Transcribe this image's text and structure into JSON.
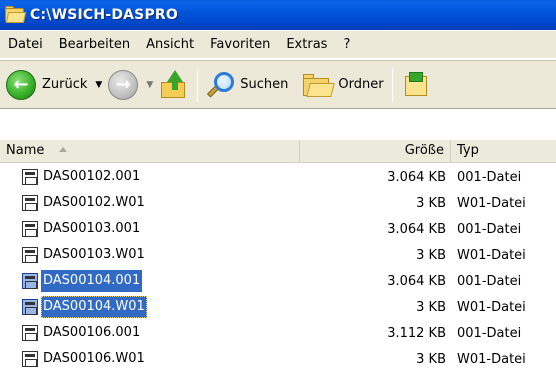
{
  "window": {
    "title": "C:\\WSICH-DASPRO"
  },
  "menu": {
    "items": [
      "Datei",
      "Bearbeiten",
      "Ansicht",
      "Favoriten",
      "Extras",
      "?"
    ]
  },
  "toolbar": {
    "back_label": "Zurück",
    "search_label": "Suchen",
    "folders_label": "Ordner",
    "icons": [
      "back-arrow-icon",
      "forward-arrow-icon",
      "folder-up-icon",
      "search-icon",
      "folders-icon",
      "views-icon"
    ]
  },
  "columns": {
    "name": "Name",
    "size": "Größe",
    "type": "Typ"
  },
  "files": [
    {
      "name": "DAS00102.001",
      "size": "3.064 KB",
      "type": "001-Datei",
      "selected": false
    },
    {
      "name": "DAS00102.W01",
      "size": "3 KB",
      "type": "W01-Datei",
      "selected": false
    },
    {
      "name": "DAS00103.001",
      "size": "3.064 KB",
      "type": "001-Datei",
      "selected": false
    },
    {
      "name": "DAS00103.W01",
      "size": "3 KB",
      "type": "W01-Datei",
      "selected": false
    },
    {
      "name": "DAS00104.001",
      "size": "3.064 KB",
      "type": "001-Datei",
      "selected": true
    },
    {
      "name": "DAS00104.W01",
      "size": "3 KB",
      "type": "W01-Datei",
      "selected": true
    },
    {
      "name": "DAS00106.001",
      "size": "3.112 KB",
      "type": "001-Datei",
      "selected": false
    },
    {
      "name": "DAS00106.W01",
      "size": "3 KB",
      "type": "W01-Datei",
      "selected": false
    }
  ],
  "colors": {
    "titlebar": "#0052d8",
    "chrome": "#ece9d8",
    "selection": "#316ac5"
  }
}
